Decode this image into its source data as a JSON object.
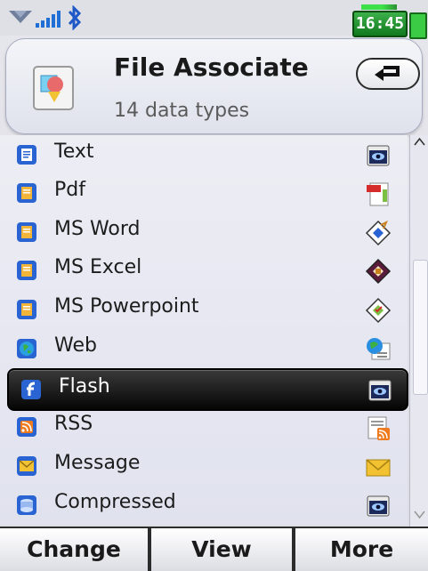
{
  "status": {
    "time": "16:45"
  },
  "header": {
    "title": "File Associate",
    "subtitle": "14 data types"
  },
  "list": {
    "items": [
      {
        "label": "Text",
        "icon": "text-file-icon",
        "app_icon": "viewer-eye-icon"
      },
      {
        "label": "Pdf",
        "icon": "pdf-file-icon",
        "app_icon": "pdf-reader-icon"
      },
      {
        "label": "MS Word",
        "icon": "word-file-icon",
        "app_icon": "word-app-icon"
      },
      {
        "label": "MS Excel",
        "icon": "excel-file-icon",
        "app_icon": "excel-app-icon"
      },
      {
        "label": "MS Powerpoint",
        "icon": "powerpoint-file-icon",
        "app_icon": "powerpoint-app-icon"
      },
      {
        "label": "Web",
        "icon": "globe-icon",
        "app_icon": "browser-icon"
      },
      {
        "label": "Flash",
        "icon": "flash-icon",
        "app_icon": "viewer-eye-icon",
        "selected": true
      },
      {
        "label": "RSS",
        "icon": "rss-icon",
        "app_icon": "rss-reader-icon"
      },
      {
        "label": "Message",
        "icon": "message-envelope-icon",
        "app_icon": "mail-icon"
      },
      {
        "label": "Compressed",
        "icon": "compressed-file-icon",
        "app_icon": "viewer-eye-icon"
      }
    ]
  },
  "softkeys": {
    "left": "Change",
    "center": "View",
    "right": "More"
  },
  "colors": {
    "selection": "#111111",
    "clock_bg": "#1f8f2a",
    "accent_blue": "#1f59c7"
  }
}
